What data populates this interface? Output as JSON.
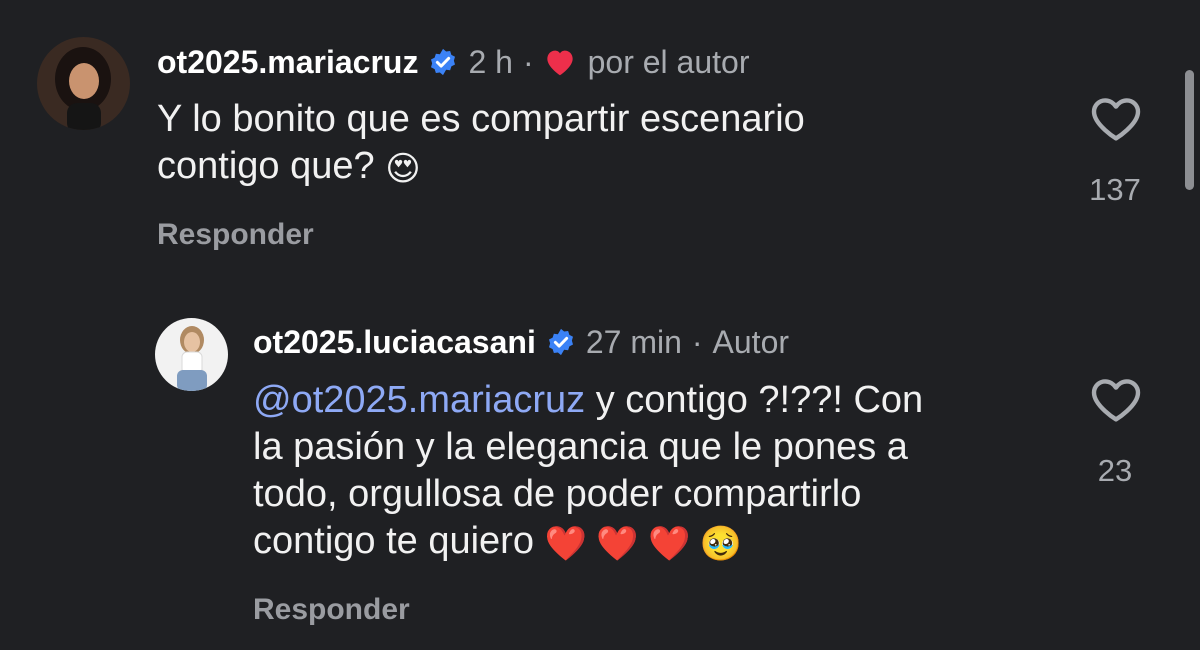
{
  "comments": [
    {
      "username": "ot2025.mariacruz",
      "time": "2 h",
      "separator": "·",
      "author_badge": "por el autor",
      "text_line1": "Y lo bonito que es compartir escenario",
      "text_line2": "contigo que?",
      "emoji": "😍",
      "reply_label": "Responder",
      "likes": "137"
    },
    {
      "username": "ot2025.luciacasani",
      "time": "27 min",
      "separator": "·",
      "author_badge": "Autor",
      "mention": "@ot2025.mariacruz",
      "text_line1": " y contigo ?!??! Con",
      "text_line2": "la pasión y la elegancia que le pones a",
      "text_line3": "todo, orgullosa de poder compartirlo",
      "text_line4": "contigo te quiero",
      "emojis": "❤️ ❤️ ❤️ 🥹",
      "reply_label": "Responder",
      "likes": "23"
    }
  ],
  "colors": {
    "background": "#1f2023",
    "heart_red": "#ed2f4b",
    "verified_blue": "#3b82f6",
    "mention_blue": "#8ea9f5"
  },
  "icons": {
    "verified": "verified-badge-icon",
    "liked_by_author": "heart-filled-icon",
    "like": "heart-outline-icon"
  }
}
